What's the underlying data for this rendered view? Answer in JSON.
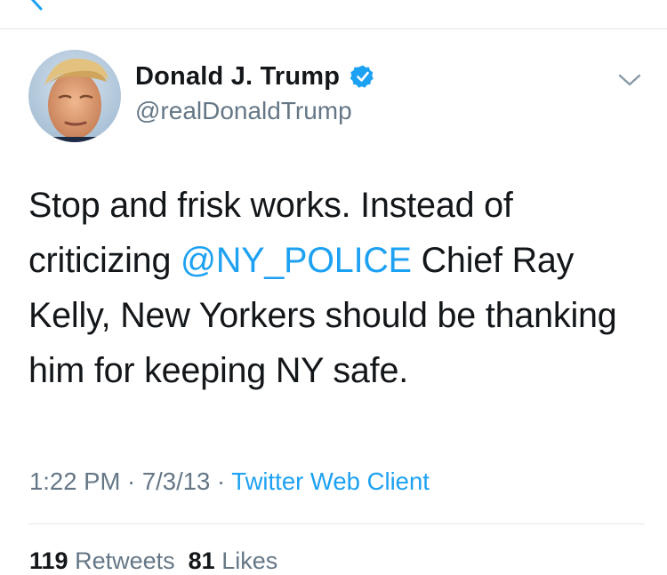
{
  "header": {
    "back_icon": "chevron-left-icon"
  },
  "tweet": {
    "author": {
      "display_name": "Donald J. Trump",
      "handle": "@realDonaldTrump",
      "verified_icon": "verified-badge-icon"
    },
    "menu_icon": "chevron-down-icon",
    "text": {
      "part1": "Stop and frisk works.  Instead of criticizing ",
      "mention": "@NY_POLICE",
      "part2": " Chief Ray Kelly, New Yorkers should be thanking him for keeping NY safe."
    },
    "meta": {
      "time": "1:22 PM",
      "separator": " · ",
      "date": "7/3/13",
      "separator2": " · ",
      "client": "Twitter Web Client"
    },
    "stats": {
      "retweets_count": "119",
      "retweets_label": "Retweets",
      "likes_count": "81",
      "likes_label": "Likes"
    }
  },
  "colors": {
    "accent": "#1da1f2",
    "secondary_text": "#657786",
    "primary_text": "#14171a",
    "divider": "#e1e8ed"
  }
}
